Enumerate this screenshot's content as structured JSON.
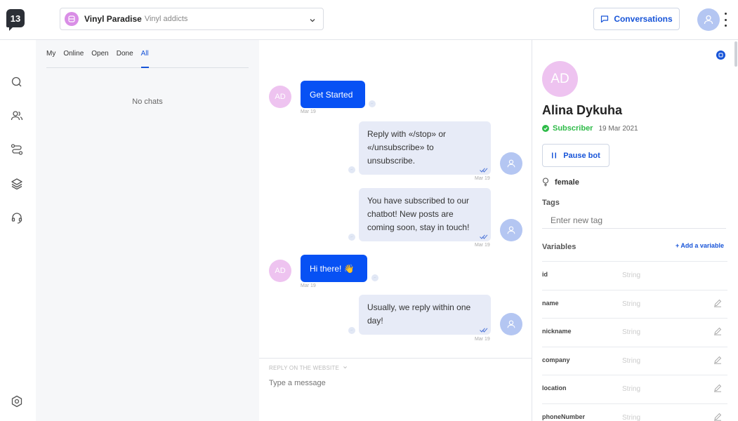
{
  "app": {
    "logo_text": "13"
  },
  "bot_selector": {
    "name": "Vinyl Paradise",
    "description": "Vinyl addicts"
  },
  "header": {
    "conversations_label": "Conversations"
  },
  "rail": {
    "items": [
      "search-icon",
      "users-icon",
      "flows-icon",
      "broadcast-icon",
      "support-icon",
      "settings-icon"
    ]
  },
  "chatlist": {
    "tabs": [
      {
        "label": "My",
        "active": false
      },
      {
        "label": "Online",
        "active": false
      },
      {
        "label": "Open",
        "active": false
      },
      {
        "label": "Done",
        "active": false
      },
      {
        "label": "All",
        "active": true
      }
    ],
    "empty_text": "No chats"
  },
  "messages": [
    {
      "from": "user",
      "avatar": "AD",
      "text": "Get Started",
      "time": "Mar 19"
    },
    {
      "from": "bot",
      "text": "Reply with «/stop» or «/unsubscribe» to unsubscribe.",
      "time": "Mar 19"
    },
    {
      "from": "bot",
      "text": "You have subscribed to our chatbot! New posts are coming soon, stay in touch!",
      "time": "Mar 19"
    },
    {
      "from": "user",
      "avatar": "AD",
      "text": "Hi there! 👋",
      "time": "Mar 19"
    },
    {
      "from": "bot",
      "text": "Usually, we reply within one day!",
      "time": "Mar 19"
    }
  ],
  "reply": {
    "label": "REPLY ON THE WEBSITE",
    "placeholder": "Type a message"
  },
  "profile": {
    "avatar": "AD",
    "name": "Alina Dykuha",
    "status": "Subscriber",
    "subscribed_date": "19 Mar 2021",
    "pause_label": "Pause bot",
    "gender": "female",
    "tags_label": "Tags",
    "tags_placeholder": "Enter new tag",
    "variables_label": "Variables",
    "add_variable_label": "+ Add a variable",
    "variables": [
      {
        "name": "id",
        "value": "String",
        "editable": false
      },
      {
        "name": "name",
        "value": "String",
        "editable": true
      },
      {
        "name": "nickname",
        "value": "String",
        "editable": true
      },
      {
        "name": "company",
        "value": "String",
        "editable": true
      },
      {
        "name": "location",
        "value": "String",
        "editable": true
      },
      {
        "name": "phoneNumber",
        "value": "String",
        "editable": true
      }
    ]
  },
  "colors": {
    "accent": "#1754d8",
    "user_bubble": "#0751f4",
    "bot_bubble": "#e7ebf7",
    "subscriber": "#2ebb48",
    "avatar_pink": "#eec3f0"
  }
}
